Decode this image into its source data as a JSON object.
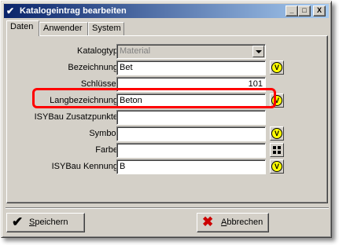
{
  "window": {
    "title": "Katalogeintrag bearbeiten",
    "icon": "checkmark-edit-icon"
  },
  "titlebar_buttons": {
    "minimize": "_",
    "maximize": "□",
    "close": "X"
  },
  "tabs": [
    {
      "label": "Daten",
      "active": true
    },
    {
      "label": "Anwender",
      "active": false
    },
    {
      "label": "System",
      "active": false
    }
  ],
  "fields": {
    "katalogtyp": {
      "label": "Katalogtyp",
      "value": "Material"
    },
    "bezeichnung": {
      "label": "Bezeichnung",
      "value": "Bet"
    },
    "schluessel": {
      "label": "Schlüssel",
      "value": "101"
    },
    "langbezeichnung": {
      "label": "Langbezeichnung",
      "value": "Beton"
    },
    "zusatzpunkte": {
      "label": "ISYBau Zusatzpunkte",
      "value": ""
    },
    "symbol": {
      "label": "Symbol",
      "value": ""
    },
    "farbe": {
      "label": "Farbe",
      "value": ""
    },
    "kennung": {
      "label": "ISYBau Kennung",
      "value": "B"
    }
  },
  "side_button_glyph": "V",
  "buttons": {
    "save": {
      "mnemonic": "S",
      "rest": "peichern",
      "icon": "checkmark-icon"
    },
    "cancel": {
      "mnemonic": "A",
      "rest": "bbrechen",
      "icon": "x-icon"
    }
  },
  "colors": {
    "highlight": "#ff0000",
    "titlebar_start": "#0a246a",
    "titlebar_end": "#a6caf0"
  }
}
